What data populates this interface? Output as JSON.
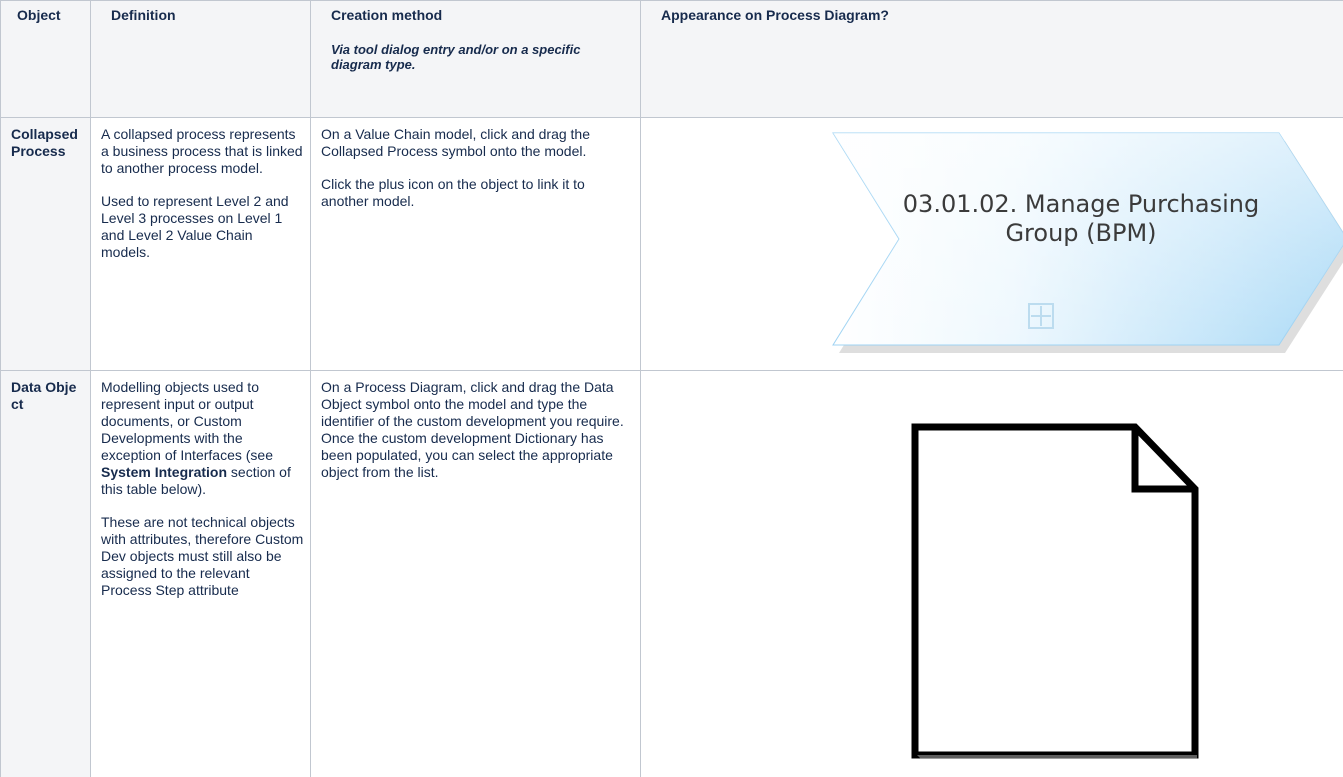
{
  "table": {
    "headers": {
      "object": "Object",
      "definition": "Definition",
      "creation": "Creation method",
      "creation_note": "Via tool dialog entry and/or on a specific diagram type.",
      "appearance": "Appearance on Process Diagram?"
    },
    "rows": [
      {
        "object": "Collapsed Process",
        "definition": [
          "A collapsed process represents a business process that is linked to another process model.",
          "Used to represent Level 2 and Level 3 processes on Level 1 and Level 2 Value Chain models."
        ],
        "creation": [
          "On a Value Chain model, click and drag the Collapsed Process symbol onto the model.",
          "Click the plus icon on the object to link it to another model."
        ],
        "shape_label": "03.01.02. Manage Purchasing Group (BPM)",
        "shape_color": "#bfe3f8"
      },
      {
        "object": "Data Object",
        "definition_part1": "Modelling objects used to represent input or output documents, or Custom Developments with the exception of Interfaces (see ",
        "definition_bold": "System Integration",
        "definition_part2": " section of this table below).",
        "definition_para2": "These are not technical objects with attributes, therefore Custom Dev objects must still also be assigned to the relevant Process Step attribute",
        "creation": [
          "On a Process Diagram, click and drag the Data Object symbol onto the model and type the identifier of the custom development you require. Once the custom development Dictionary has been populated, you can select the appropriate object from the list."
        ]
      }
    ]
  }
}
